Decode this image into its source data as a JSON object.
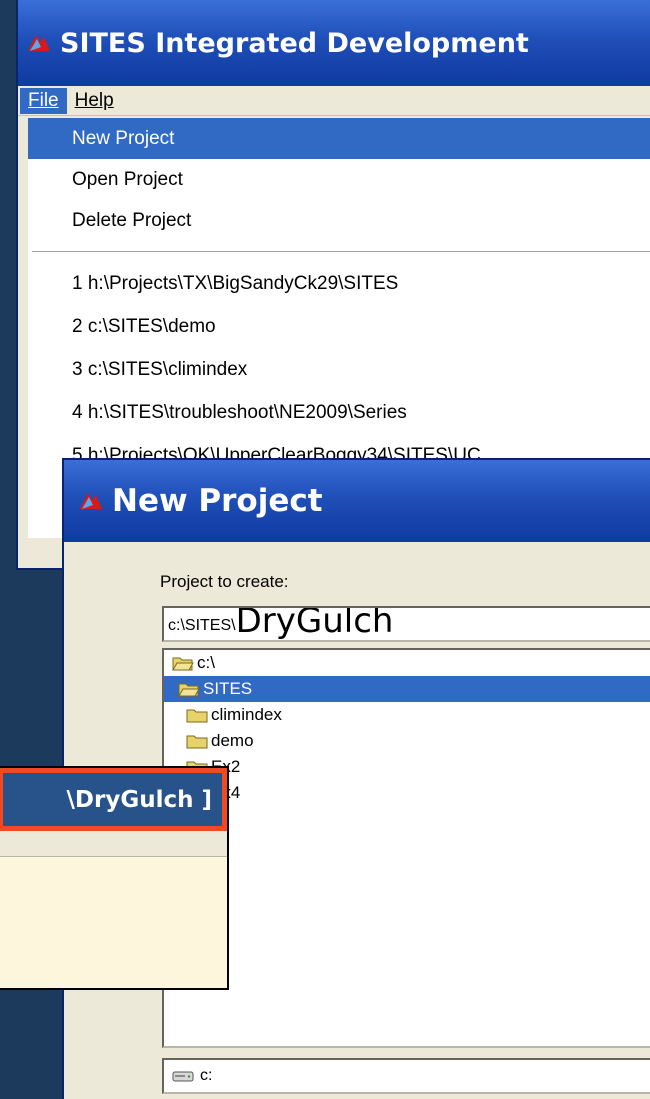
{
  "ide": {
    "title": "SITES Integrated Development"
  },
  "menubar": {
    "file": "File",
    "help": "Help"
  },
  "file_menu": {
    "items": [
      "New Project",
      "Open Project",
      "Delete Project"
    ],
    "recent": [
      "1 h:\\Projects\\TX\\BigSandyCk29\\SITES",
      "2 c:\\SITES\\demo",
      "3 c:\\SITES\\climindex",
      "4 h:\\SITES\\troubleshoot\\NE2009\\Series",
      "5 h:\\Projects\\OK\\UpperClearBoggy34\\SITES\\UC"
    ]
  },
  "dialog": {
    "title": "New Project",
    "label": "Project to create:",
    "path_prefix": "c:\\SITES\\",
    "path_typed": "DryGulch",
    "folders": [
      "c:\\",
      "SITES",
      "climindex",
      "demo",
      "Ex2",
      "Ex4"
    ],
    "drive": "c:"
  },
  "callout": {
    "text": "\\DryGulch ]"
  },
  "colors": {
    "titlebar": "#1f4fb8",
    "selection": "#316ac5",
    "callout_border": "#ef4a23",
    "background": "#1b3a5c"
  }
}
